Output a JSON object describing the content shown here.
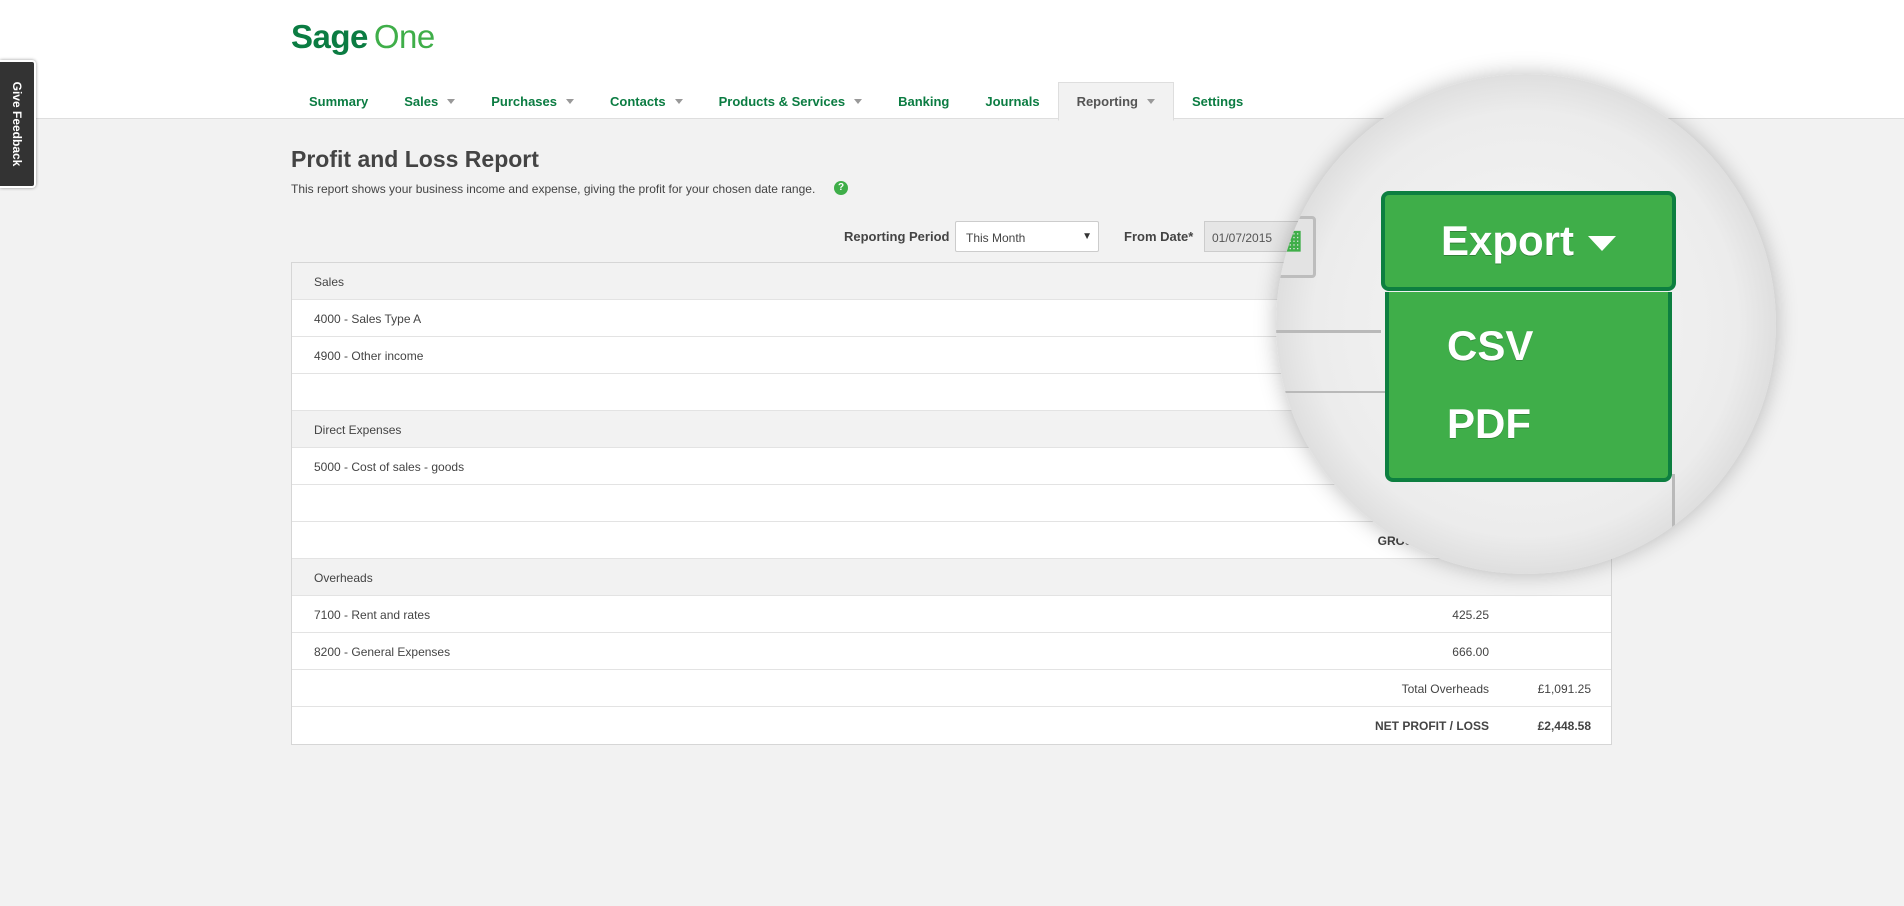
{
  "logo": {
    "brand": "Sage",
    "product": "One"
  },
  "feedback": {
    "label": "Give Feedback"
  },
  "nav": {
    "summary": "Summary",
    "sales": "Sales",
    "purchases": "Purchases",
    "contacts": "Contacts",
    "products": "Products & Services",
    "banking": "Banking",
    "journals": "Journals",
    "reporting": "Reporting",
    "settings": "Settings"
  },
  "page": {
    "title": "Profit and Loss Report",
    "description": "This report shows your business income and expense, giving the profit for your chosen date range.",
    "help": "?"
  },
  "filters": {
    "period_label": "Reporting Period",
    "period_value": "This Month",
    "from_label": "From Date*",
    "from_value": "01/07/2015"
  },
  "report": {
    "sales_header": "Sales",
    "sales_a": "4000 - Sales Type A",
    "sales_other": "4900 - Other income",
    "direct_header": "Direct Expenses",
    "direct_cost": "5000 - Cost of sales - goods",
    "gross_label": "GROSS",
    "overheads_header": "Overheads",
    "rent_label": "7100 - Rent and rates",
    "rent_value": "425.25",
    "general_label": "8200 - General Expenses",
    "general_value": "666.00",
    "total_overheads_label": "Total Overheads",
    "total_overheads_value": "£1,091.25",
    "net_label": "NET PROFIT / LOSS",
    "net_value": "£2,448.58"
  },
  "export": {
    "button": "Export",
    "csv": "CSV",
    "pdf": "PDF"
  },
  "colors": {
    "brand_dark": "#0b7c42",
    "brand_green": "#3fae49",
    "border_green": "#0d7f40"
  }
}
